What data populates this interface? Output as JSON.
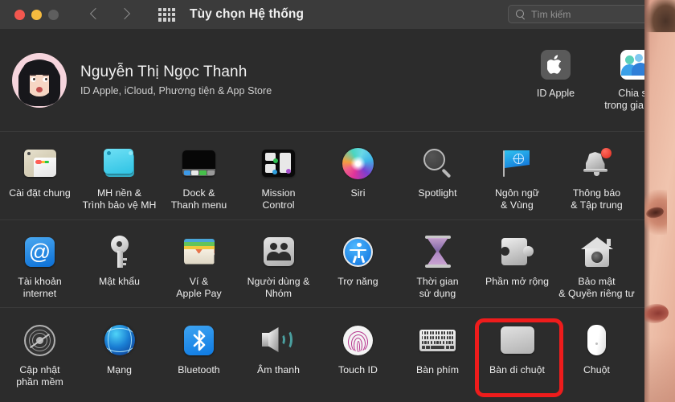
{
  "window": {
    "title": "Tùy chọn Hệ thống",
    "traffic_lights": [
      "close",
      "minimize",
      "zoom"
    ],
    "nav_back": "back-arrow",
    "nav_forward": "forward-arrow",
    "grid_button": "show-all-grid-icon"
  },
  "search": {
    "placeholder": "Tìm kiếm",
    "value": "",
    "icon": "search-icon"
  },
  "account": {
    "name": "Nguyễn Thị Ngọc Thanh",
    "subtitle": "ID Apple, iCloud, Phương tiện & App Store",
    "avatar": "memoji-avatar",
    "tiles": [
      {
        "label": "ID Apple",
        "icon": "apple-logo-icon"
      },
      {
        "label": "Chia sẻ\ntrong gia đình",
        "line1": "Chia sẻ",
        "line2": "trong gia đình",
        "icon": "family-sharing-icon"
      }
    ]
  },
  "colors": {
    "window_bg": "#2c2c2c",
    "titlebar_bg": "#3b3b3b",
    "text_primary": "#f0f0f0",
    "text_secondary": "#d0d0d0",
    "highlight_red": "#ee1c1c",
    "traffic_red": "#f2574f",
    "traffic_yellow": "#f6bb3f",
    "traffic_gray": "#5e5e5e"
  },
  "annotation": {
    "highlighted_item": "Bàn di chuột",
    "shape": "rounded-rectangle",
    "color": "#ee1c1c"
  },
  "grid": {
    "rows": [
      {
        "items": [
          {
            "label": "Cài đặt chung",
            "line1": "Cài đặt chung",
            "line2": "",
            "icon": "general-icon"
          },
          {
            "label": "MH nền & Trình bảo vệ MH",
            "line1": "MH nền &",
            "line2": "Trình bảo vệ MH",
            "icon": "desktop-screensaver-icon"
          },
          {
            "label": "Dock & Thanh menu",
            "line1": "Dock &",
            "line2": "Thanh menu",
            "icon": "dock-menubar-icon"
          },
          {
            "label": "Mission Control",
            "line1": "Mission",
            "line2": "Control",
            "icon": "mission-control-icon"
          },
          {
            "label": "Siri",
            "line1": "Siri",
            "line2": "",
            "icon": "siri-icon"
          },
          {
            "label": "Spotlight",
            "line1": "Spotlight",
            "line2": "",
            "icon": "spotlight-icon"
          },
          {
            "label": "Ngôn ngữ & Vùng",
            "line1": "Ngôn ngữ",
            "line2": "& Vùng",
            "icon": "language-region-icon"
          },
          {
            "label": "Thông báo & Tập trung",
            "line1": "Thông báo",
            "line2": "& Tập trung",
            "icon": "notifications-focus-icon"
          }
        ]
      },
      {
        "items": [
          {
            "label": "Tài khoản internet",
            "line1": "Tài khoản",
            "line2": "internet",
            "icon": "internet-accounts-icon"
          },
          {
            "label": "Mật khẩu",
            "line1": "Mật khẩu",
            "line2": "",
            "icon": "passwords-key-icon"
          },
          {
            "label": "Ví & Apple Pay",
            "line1": "Ví &",
            "line2": "Apple Pay",
            "icon": "wallet-applepay-icon"
          },
          {
            "label": "Người dùng & Nhóm",
            "line1": "Người dùng &",
            "line2": "Nhóm",
            "icon": "users-groups-icon"
          },
          {
            "label": "Trợ năng",
            "line1": "Trợ năng",
            "line2": "",
            "icon": "accessibility-icon"
          },
          {
            "label": "Thời gian sử dụng",
            "line1": "Thời gian",
            "line2": "sử dụng",
            "icon": "screen-time-hourglass-icon"
          },
          {
            "label": "Phần mở rộng",
            "line1": "Phần mở rộng",
            "line2": "",
            "icon": "extensions-puzzle-icon"
          },
          {
            "label": "Bảo mật & Quyền riêng tư",
            "line1": "Bảo mật",
            "line2": "& Quyền riêng tư",
            "icon": "security-privacy-icon"
          }
        ]
      },
      {
        "items": [
          {
            "label": "Cập nhật phần mềm",
            "line1": "Cập nhật",
            "line2": "phần mềm",
            "icon": "software-update-icon"
          },
          {
            "label": "Mạng",
            "line1": "Mạng",
            "line2": "",
            "icon": "network-globe-icon"
          },
          {
            "label": "Bluetooth",
            "line1": "Bluetooth",
            "line2": "",
            "icon": "bluetooth-icon"
          },
          {
            "label": "Âm thanh",
            "line1": "Âm thanh",
            "line2": "",
            "icon": "sound-speaker-icon"
          },
          {
            "label": "Touch ID",
            "line1": "Touch ID",
            "line2": "",
            "icon": "touch-id-icon"
          },
          {
            "label": "Bàn phím",
            "line1": "Bàn phím",
            "line2": "",
            "icon": "keyboard-icon"
          },
          {
            "label": "Bàn di chuột",
            "line1": "Bàn di chuột",
            "line2": "",
            "icon": "trackpad-icon"
          },
          {
            "label": "Chuột",
            "line1": "Chuột",
            "line2": "",
            "icon": "mouse-icon"
          }
        ]
      }
    ]
  }
}
